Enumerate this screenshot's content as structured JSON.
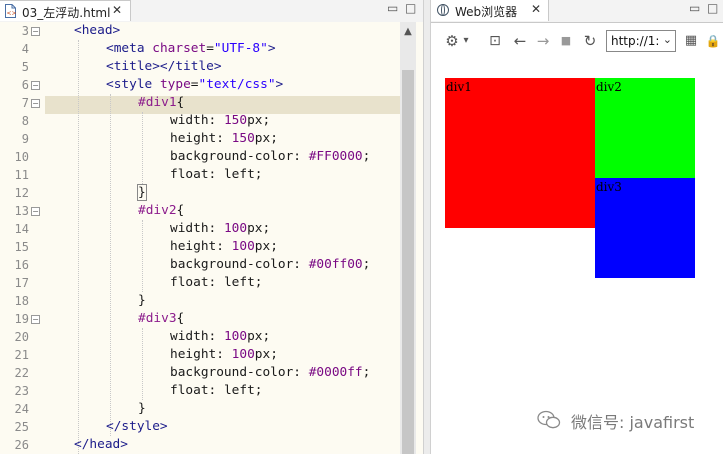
{
  "editor": {
    "tab_label": "03_左浮动.html",
    "tab_close": "✕",
    "minimize": "▭",
    "maximize": "□",
    "lines": [
      {
        "no": "3",
        "fold": "−"
      },
      {
        "no": "4",
        "fold": ""
      },
      {
        "no": "5",
        "fold": ""
      },
      {
        "no": "6",
        "fold": "−"
      },
      {
        "no": "7",
        "fold": "−"
      },
      {
        "no": "8",
        "fold": ""
      },
      {
        "no": "9",
        "fold": ""
      },
      {
        "no": "10",
        "fold": ""
      },
      {
        "no": "11",
        "fold": ""
      },
      {
        "no": "12",
        "fold": ""
      },
      {
        "no": "13",
        "fold": "−"
      },
      {
        "no": "14",
        "fold": ""
      },
      {
        "no": "15",
        "fold": ""
      },
      {
        "no": "16",
        "fold": ""
      },
      {
        "no": "17",
        "fold": ""
      },
      {
        "no": "18",
        "fold": ""
      },
      {
        "no": "19",
        "fold": "−"
      },
      {
        "no": "20",
        "fold": ""
      },
      {
        "no": "21",
        "fold": ""
      },
      {
        "no": "22",
        "fold": ""
      },
      {
        "no": "23",
        "fold": ""
      },
      {
        "no": "24",
        "fold": ""
      },
      {
        "no": "25",
        "fold": ""
      },
      {
        "no": "26",
        "fold": ""
      }
    ],
    "code": {
      "l3": {
        "open": "<head>"
      },
      "l4": {
        "open": "<meta",
        "attr": "charset",
        "eq": "=",
        "val": "\"UTF-8\"",
        "close": ">"
      },
      "l5": {
        "text": "<title></title>"
      },
      "l6": {
        "open": "<style",
        "attr": "type",
        "eq": "=",
        "val": "\"text/css\"",
        "close": ">"
      },
      "l7": {
        "sel": "#div1",
        "brace": "{"
      },
      "l8": {
        "prop": "width:",
        "val": "150",
        "unit": "px",
        "end": ";"
      },
      "l9": {
        "prop": "height:",
        "val": "150",
        "unit": "px",
        "end": ";"
      },
      "l10": {
        "prop": "background-color:",
        "val": "#FF0000",
        "end": ";"
      },
      "l11": {
        "prop": "float:",
        "val": "left",
        "end": ";"
      },
      "l12": {
        "brace": "}"
      },
      "l13": {
        "sel": "#div2",
        "brace": "{"
      },
      "l14": {
        "prop": "width:",
        "val": "100",
        "unit": "px",
        "end": ";"
      },
      "l15": {
        "prop": "height:",
        "val": "100",
        "unit": "px",
        "end": ";"
      },
      "l16": {
        "prop": "background-color:",
        "val": "#00ff00",
        "end": ";"
      },
      "l17": {
        "prop": "float:",
        "val": "left",
        "end": ";"
      },
      "l18": {
        "brace": "}"
      },
      "l19": {
        "sel": "#div3",
        "brace": "{"
      },
      "l20": {
        "prop": "width:",
        "val": "100",
        "unit": "px",
        "end": ";"
      },
      "l21": {
        "prop": "height:",
        "val": "100",
        "unit": "px",
        "end": ";"
      },
      "l22": {
        "prop": "background-color:",
        "val": "#0000ff",
        "end": ";"
      },
      "l23": {
        "prop": "float:",
        "val": "left",
        "end": ";"
      },
      "l24": {
        "brace": "}"
      },
      "l25": {
        "text": "</style>"
      },
      "l26": {
        "text": "</head>"
      }
    },
    "scroll_up": "▲"
  },
  "browser": {
    "tab_label": "Web浏览器",
    "tab_close": "✕",
    "minimize": "▭",
    "maximize": "□",
    "toolbar": {
      "settings_icon": "⚙",
      "settings_caret": "▾",
      "console_icon": "⊡",
      "back_icon": "←",
      "forward_icon": "→",
      "stop_icon": "■",
      "refresh_icon": "↻",
      "url": "http://1:",
      "url_caret": "⌄",
      "qr_icon": "▦",
      "lock_icon": "🔒"
    },
    "boxes": [
      {
        "label": "div1",
        "color": "#FF0000"
      },
      {
        "label": "div2",
        "color": "#00ff00"
      },
      {
        "label": "div3",
        "color": "#0000ff"
      }
    ]
  },
  "watermark": {
    "text": "微信号: javafirst"
  }
}
